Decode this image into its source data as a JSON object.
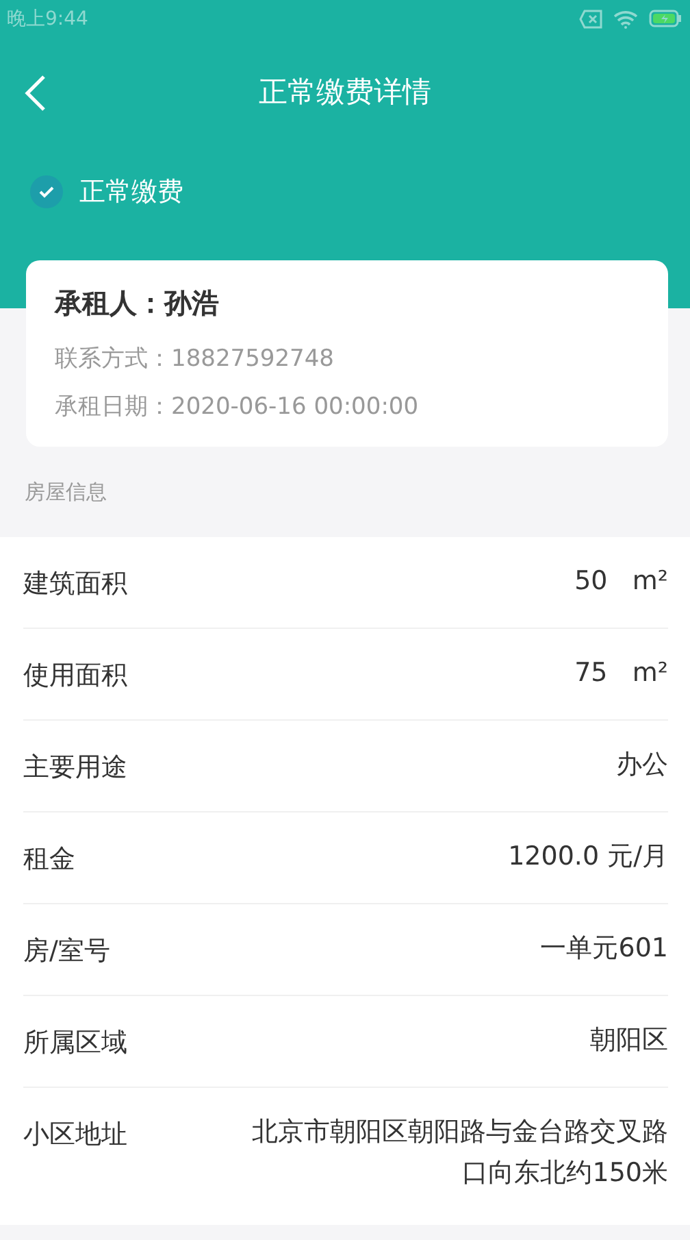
{
  "status_bar": {
    "time": "晚上9:44"
  },
  "header": {
    "title": "正常缴费详情"
  },
  "payment_status": {
    "label": "正常缴费",
    "checked": true
  },
  "tenant": {
    "name": "承租人：孙浩",
    "contact": "联系方式：18827592748",
    "date": "承租日期：2020-06-16 00:00:00"
  },
  "section_title": "房屋信息",
  "rows": [
    {
      "label": "建筑面积",
      "value": "50   m²"
    },
    {
      "label": "使用面积",
      "value": "75   m²"
    },
    {
      "label": "主要用途",
      "value": "办公"
    },
    {
      "label": "租金",
      "value": "1200.0 元/月"
    },
    {
      "label": "房/室号",
      "value": "一单元601"
    },
    {
      "label": "所属区域",
      "value": "朝阳区"
    },
    {
      "label": "小区地址",
      "value": "北京市朝阳区朝阳路与金台路交叉路口向东北约150米"
    }
  ]
}
